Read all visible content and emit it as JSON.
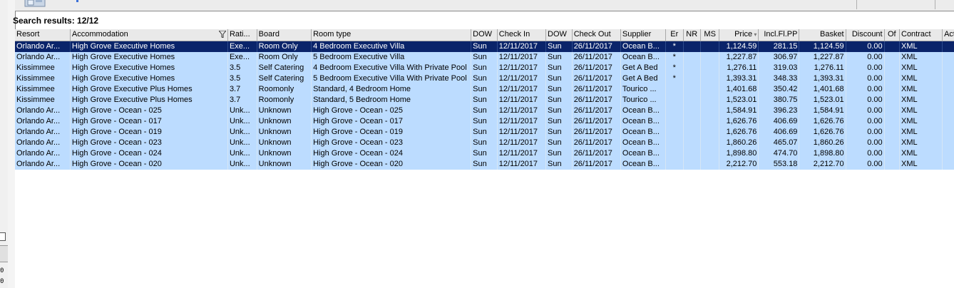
{
  "results": {
    "label": "Search results: 12/12"
  },
  "columns": [
    {
      "key": "resort",
      "label": "Resort",
      "width": 76,
      "align": "left"
    },
    {
      "key": "accommodation",
      "label": "Accommodation",
      "width": 217,
      "align": "left"
    },
    {
      "key": "rating",
      "label": "Rati...",
      "width": 40,
      "align": "left"
    },
    {
      "key": "board",
      "label": "Board",
      "width": 75,
      "align": "left"
    },
    {
      "key": "room_type",
      "label": "Room type",
      "width": 220,
      "align": "left"
    },
    {
      "key": "dow1",
      "label": "DOW",
      "width": 36,
      "align": "left"
    },
    {
      "key": "check_in",
      "label": "Check In",
      "width": 67,
      "align": "left"
    },
    {
      "key": "dow2",
      "label": "DOW",
      "width": 36,
      "align": "left"
    },
    {
      "key": "check_out",
      "label": "Check Out",
      "width": 67,
      "align": "left"
    },
    {
      "key": "supplier",
      "label": "Supplier",
      "width": 62,
      "align": "left"
    },
    {
      "key": "er",
      "label": "Er",
      "width": 24,
      "align": "center"
    },
    {
      "key": "nr",
      "label": "NR",
      "width": 24,
      "align": "center"
    },
    {
      "key": "ms",
      "label": "MS",
      "width": 26,
      "align": "center"
    },
    {
      "key": "price",
      "label": "Price",
      "width": 54,
      "align": "right"
    },
    {
      "key": "incl",
      "label": "Incl.Fl.PP",
      "width": 56,
      "align": "right"
    },
    {
      "key": "basket",
      "label": "Basket",
      "width": 64,
      "align": "right"
    },
    {
      "key": "discount",
      "label": "Discount",
      "width": 53,
      "align": "right"
    },
    {
      "key": "of",
      "label": "Of",
      "width": 21,
      "align": "center"
    },
    {
      "key": "contract",
      "label": "Contract",
      "width": 59,
      "align": "left"
    },
    {
      "key": "act",
      "label": "Act. S",
      "width": 40,
      "align": "left"
    }
  ],
  "rows": [
    {
      "selected": true,
      "cells": [
        "Orlando Ar...",
        "High Grove Executive Homes",
        "Exe...",
        "Room Only",
        "4 Bedroom Executive Villa",
        "Sun",
        "12/11/2017",
        "Sun",
        "26/11/2017",
        "Ocean B...",
        "*",
        "",
        "",
        "1,124.59",
        "281.15",
        "1,124.59",
        "0.00",
        "",
        "XML",
        ""
      ]
    },
    {
      "selected": false,
      "cells": [
        "Orlando Ar...",
        "High Grove Executive Homes",
        "Exe...",
        "Room Only",
        "5 Bedroom Executive Villa",
        "Sun",
        "12/11/2017",
        "Sun",
        "26/11/2017",
        "Ocean B...",
        "*",
        "",
        "",
        "1,227.87",
        "306.97",
        "1,227.87",
        "0.00",
        "",
        "XML",
        ""
      ]
    },
    {
      "selected": false,
      "cells": [
        "Kissimmee",
        "High Grove Executive Homes",
        "3.5",
        "Self Catering",
        "4 Bedroom Executive Villa With Private Pool",
        "Sun",
        "12/11/2017",
        "Sun",
        "26/11/2017",
        "Get A Bed",
        "*",
        "",
        "",
        "1,276.11",
        "319.03",
        "1,276.11",
        "0.00",
        "",
        "XML",
        ""
      ]
    },
    {
      "selected": false,
      "cells": [
        "Kissimmee",
        "High Grove Executive Homes",
        "3.5",
        "Self Catering",
        "5 Bedroom Executive Villa With Private Pool",
        "Sun",
        "12/11/2017",
        "Sun",
        "26/11/2017",
        "Get A Bed",
        "*",
        "",
        "",
        "1,393.31",
        "348.33",
        "1,393.31",
        "0.00",
        "",
        "XML",
        ""
      ]
    },
    {
      "selected": false,
      "cells": [
        "Kissimmee",
        "High Grove Executive Plus Homes",
        "3.7",
        "Roomonly",
        "Standard, 4 Bedroom Home",
        "Sun",
        "12/11/2017",
        "Sun",
        "26/11/2017",
        "Tourico ...",
        "",
        "",
        "",
        "1,401.68",
        "350.42",
        "1,401.68",
        "0.00",
        "",
        "XML",
        ""
      ]
    },
    {
      "selected": false,
      "cells": [
        "Kissimmee",
        "High Grove Executive Plus Homes",
        "3.7",
        "Roomonly",
        "Standard, 5 Bedroom Home",
        "Sun",
        "12/11/2017",
        "Sun",
        "26/11/2017",
        "Tourico ...",
        "",
        "",
        "",
        "1,523.01",
        "380.75",
        "1,523.01",
        "0.00",
        "",
        "XML",
        ""
      ]
    },
    {
      "selected": false,
      "cells": [
        "Orlando Ar...",
        "High Grove - Ocean - 025",
        "Unk...",
        "Unknown",
        "High Grove - Ocean - 025",
        "Sun",
        "12/11/2017",
        "Sun",
        "26/11/2017",
        "Ocean B...",
        "",
        "",
        "",
        "1,584.91",
        "396.23",
        "1,584.91",
        "0.00",
        "",
        "XML",
        ""
      ]
    },
    {
      "selected": false,
      "cells": [
        "Orlando Ar...",
        "High Grove - Ocean - 017",
        "Unk...",
        "Unknown",
        "High Grove - Ocean - 017",
        "Sun",
        "12/11/2017",
        "Sun",
        "26/11/2017",
        "Ocean B...",
        "",
        "",
        "",
        "1,626.76",
        "406.69",
        "1,626.76",
        "0.00",
        "",
        "XML",
        ""
      ]
    },
    {
      "selected": false,
      "cells": [
        "Orlando Ar...",
        "High Grove - Ocean - 019",
        "Unk...",
        "Unknown",
        "High Grove - Ocean - 019",
        "Sun",
        "12/11/2017",
        "Sun",
        "26/11/2017",
        "Ocean B...",
        "",
        "",
        "",
        "1,626.76",
        "406.69",
        "1,626.76",
        "0.00",
        "",
        "XML",
        ""
      ]
    },
    {
      "selected": false,
      "cells": [
        "Orlando Ar...",
        "High Grove - Ocean - 023",
        "Unk...",
        "Unknown",
        "High Grove - Ocean - 023",
        "Sun",
        "12/11/2017",
        "Sun",
        "26/11/2017",
        "Ocean B...",
        "",
        "",
        "",
        "1,860.26",
        "465.07",
        "1,860.26",
        "0.00",
        "",
        "XML",
        ""
      ]
    },
    {
      "selected": false,
      "cells": [
        "Orlando Ar...",
        "High Grove - Ocean - 024",
        "Unk...",
        "Unknown",
        "High Grove - Ocean - 024",
        "Sun",
        "12/11/2017",
        "Sun",
        "26/11/2017",
        "Ocean B...",
        "",
        "",
        "",
        "1,898.80",
        "474.70",
        "1,898.80",
        "0.00",
        "",
        "XML",
        ""
      ]
    },
    {
      "selected": false,
      "cells": [
        "Orlando Ar...",
        "High Grove - Ocean - 020",
        "Unk...",
        "Unknown",
        "High Grove - Ocean - 020",
        "Sun",
        "12/11/2017",
        "Sun",
        "26/11/2017",
        "Ocean B...",
        "",
        "",
        "",
        "2,212.70",
        "553.18",
        "2,212.70",
        "0.00",
        "",
        "XML",
        ""
      ]
    }
  ],
  "left_panel": {
    "digits": [
      "0",
      "0"
    ]
  },
  "icons": {
    "filter": "filter-icon",
    "sort": "sort-descending-icon",
    "toolbar": "search-toolbar-icon"
  },
  "colors": {
    "selected_row": "#0a246a",
    "row": "#bcdcff",
    "header": "#e9e9e9"
  }
}
